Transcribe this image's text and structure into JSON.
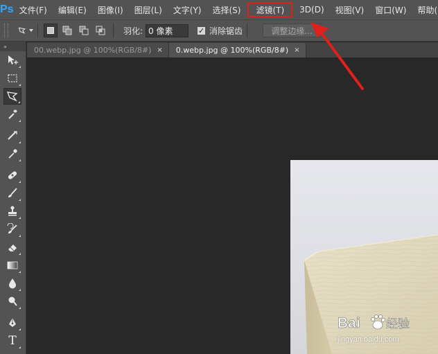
{
  "app": {
    "logo_text": "Ps"
  },
  "menubar": {
    "items": [
      {
        "label": "文件(F)"
      },
      {
        "label": "编辑(E)"
      },
      {
        "label": "图像(I)"
      },
      {
        "label": "图层(L)"
      },
      {
        "label": "文字(Y)"
      },
      {
        "label": "选择(S)"
      },
      {
        "label": "滤镜(T)",
        "highlighted": true
      },
      {
        "label": "3D(D)"
      },
      {
        "label": "视图(V)"
      },
      {
        "label": "窗口(W)"
      },
      {
        "label": "帮助(H)"
      }
    ]
  },
  "options": {
    "current_tool_icon": "polygonal-lasso-icon",
    "selection_modes": [
      "new-selection",
      "add-to-selection",
      "subtract-from-selection",
      "intersect-with-selection"
    ],
    "active_mode": "new-selection",
    "feather_label": "羽化:",
    "feather_value": "0 像素",
    "antialias_label": "消除锯齿",
    "antialias_checked": true,
    "refine_edge_label": "调整边缘..."
  },
  "toolbox": {
    "header": "»",
    "tools": [
      "move-icon",
      "rect-marquee-icon",
      "polygonal-lasso-icon",
      "magic-wand-icon",
      "crop-icon",
      "eyedropper-icon",
      "healing-brush-icon",
      "brush-icon",
      "clone-stamp-icon",
      "history-brush-icon",
      "eraser-icon",
      "gradient-icon",
      "blur-icon",
      "dodge-icon",
      "pen-icon",
      "type-icon"
    ],
    "active_tool": "polygonal-lasso-icon",
    "type_glyph": "T"
  },
  "tabs": [
    {
      "label": "00.webp.jpg @ 100%(RGB/8#)",
      "active": false,
      "close": "×"
    },
    {
      "label": "0.webp.jpg @ 100%(RGB/8#)",
      "active": true,
      "close": "×"
    }
  ],
  "watermark": {
    "brand": "Bai",
    "brand_suffix": "经验",
    "url": "jingyan.baidu.com"
  },
  "colors": {
    "annotation_red": "#e0201a",
    "ps_blue": "#31a8ff",
    "ui_panel": "#535353",
    "canvas_bg": "#282828"
  }
}
